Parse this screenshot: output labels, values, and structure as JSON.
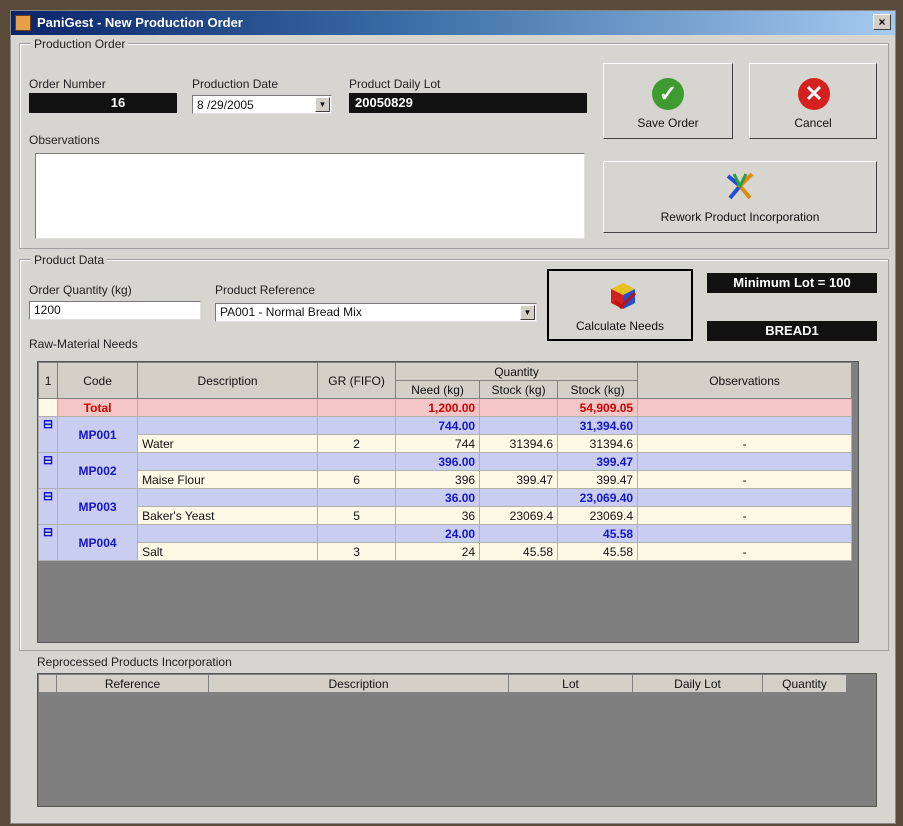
{
  "window": {
    "title": "PaniGest - New Production Order",
    "close_glyph": "×"
  },
  "production_order": {
    "group_title": "Production Order",
    "order_number_label": "Order Number",
    "order_number": "16",
    "production_date_label": "Production Date",
    "production_date": "8 /29/2005",
    "daily_lot_label": "Product Daily Lot",
    "daily_lot": "20050829",
    "observations_label": "Observations",
    "observations": ""
  },
  "buttons": {
    "save": "Save Order",
    "cancel": "Cancel",
    "rework": "Rework Product Incorporation",
    "calculate": "Calculate Needs",
    "save_icon": "check-icon",
    "cancel_icon": "x-icon"
  },
  "product_data": {
    "group_title": "Product Data",
    "order_quantity_label": "Order Quantity (kg)",
    "order_quantity": "1200",
    "product_reference_label": "Product Reference",
    "product_reference": "PA001 - Normal Bread Mix",
    "minimum_lot": "Minimum Lot = 100",
    "product_code": "BREAD1"
  },
  "raw_materials": {
    "title": "Raw-Material Needs",
    "headers": {
      "index": "1",
      "code": "Code",
      "description": "Description",
      "gr": "GR (FIFO)",
      "quantity": "Quantity",
      "need": "Need (kg)",
      "stock": "Stock (kg)",
      "stock2": "Stock (kg)",
      "observations": "Observations"
    },
    "total": {
      "label": "Total",
      "need": "1,200.00",
      "stock2": "54,909.05"
    },
    "items": [
      {
        "code": "MP001",
        "group_need": "744.00",
        "group_stock": "31,394.60",
        "description": "Water",
        "gr": "2",
        "need": "744",
        "stock": "31394.6",
        "stock2": "31394.6",
        "obs": "-"
      },
      {
        "code": "MP002",
        "group_need": "396.00",
        "group_stock": "399.47",
        "description": "Maise Flour",
        "gr": "6",
        "need": "396",
        "stock": "399.47",
        "stock2": "399.47",
        "obs": "-"
      },
      {
        "code": "MP003",
        "group_need": "36.00",
        "group_stock": "23,069.40",
        "description": "Baker's Yeast",
        "gr": "5",
        "need": "36",
        "stock": "23069.4",
        "stock2": "23069.4",
        "obs": "-"
      },
      {
        "code": "MP004",
        "group_need": "24.00",
        "group_stock": "45.58",
        "description": "Salt",
        "gr": "3",
        "need": "24",
        "stock": "45.58",
        "stock2": "45.58",
        "obs": "-"
      }
    ]
  },
  "reprocessed": {
    "title": "Reprocessed Products Incorporation",
    "headers": [
      "Reference",
      "Description",
      "Lot",
      "Daily Lot",
      "Quantity"
    ]
  }
}
